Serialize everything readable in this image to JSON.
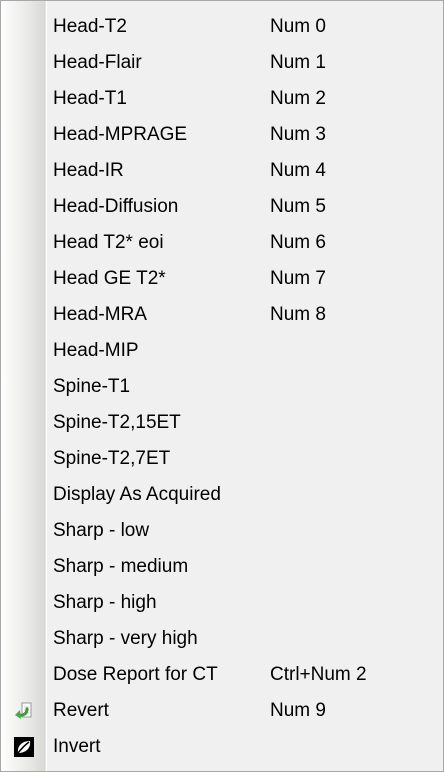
{
  "menu": {
    "items": [
      {
        "label": "Head-T2",
        "shortcut": "Num 0"
      },
      {
        "label": "Head-Flair",
        "shortcut": "Num 1"
      },
      {
        "label": "Head-T1",
        "shortcut": "Num 2"
      },
      {
        "label": "Head-MPRAGE",
        "shortcut": "Num 3"
      },
      {
        "label": "Head-IR",
        "shortcut": "Num 4"
      },
      {
        "label": "Head-Diffusion",
        "shortcut": "Num 5"
      },
      {
        "label": "Head T2* eoi",
        "shortcut": "Num 6"
      },
      {
        "label": "Head GE T2*",
        "shortcut": "Num 7"
      },
      {
        "label": "Head-MRA",
        "shortcut": "Num 8"
      },
      {
        "label": "Head-MIP",
        "shortcut": ""
      },
      {
        "label": "Spine-T1",
        "shortcut": ""
      },
      {
        "label": "Spine-T2,15ET",
        "shortcut": ""
      },
      {
        "label": "Spine-T2,7ET",
        "shortcut": ""
      },
      {
        "label": "Display As Acquired",
        "shortcut": ""
      },
      {
        "label": "Sharp - low",
        "shortcut": ""
      },
      {
        "label": "Sharp - medium",
        "shortcut": ""
      },
      {
        "label": "Sharp - high",
        "shortcut": ""
      },
      {
        "label": "Sharp - very high",
        "shortcut": ""
      },
      {
        "label": "Dose Report for CT",
        "shortcut": "Ctrl+Num 2"
      },
      {
        "label": "Revert",
        "shortcut": "Num 9",
        "icon": "revert-arrow-icon"
      },
      {
        "label": "Invert",
        "shortcut": "",
        "icon": "invert-contrast-icon"
      }
    ]
  },
  "colors": {
    "menu_background": "#f0f0f0",
    "text": "#000000",
    "border": "#a8a8a8",
    "revert_icon_green": "#4aa84a"
  }
}
